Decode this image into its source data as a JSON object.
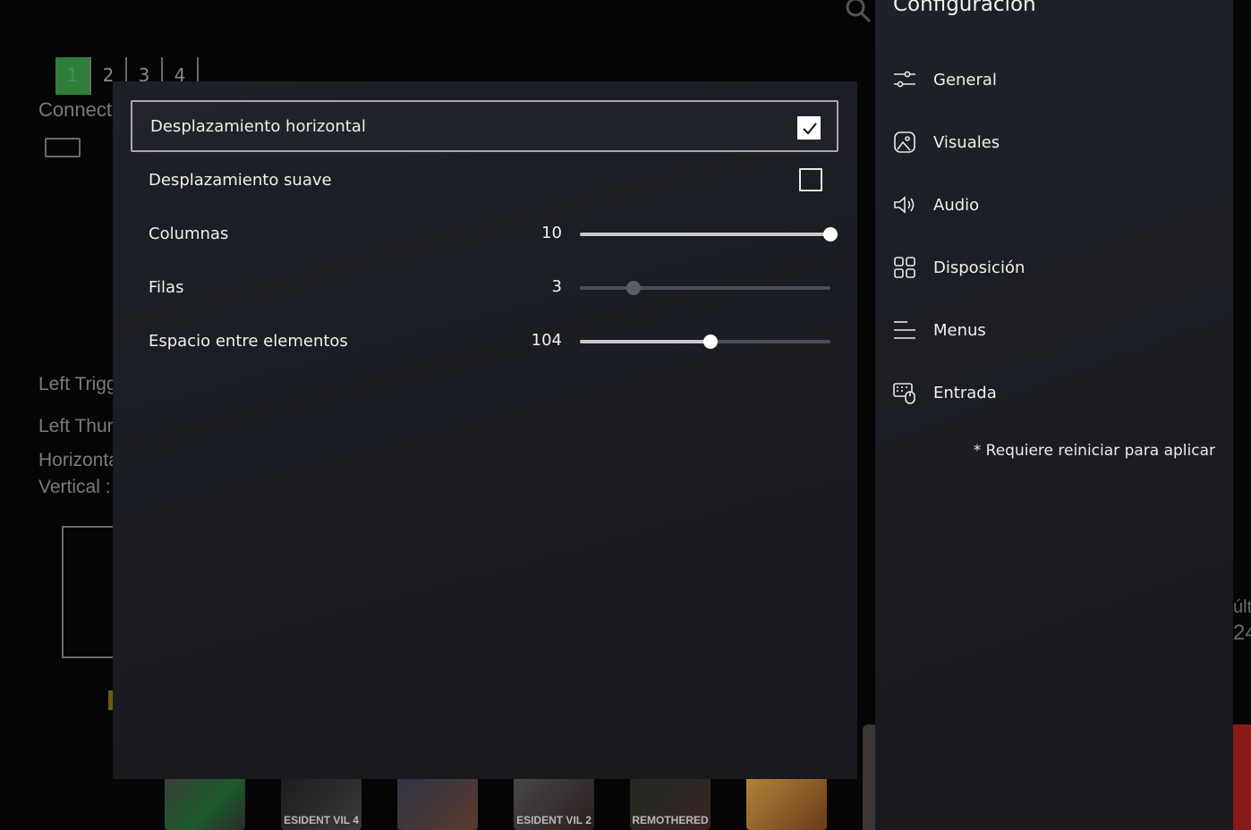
{
  "background": {
    "player_tabs": [
      "1",
      "2",
      "3",
      "4"
    ],
    "active_player_tab": "1",
    "connected_text": "Connecte",
    "left_trigger_text": "Left Trigg",
    "left_thumb_text": "Left Thun",
    "horizontal_text": "Horizonta",
    "vertical_text": "Vertical :",
    "right_edge_text_1": "últi",
    "right_edge_text_2": "24",
    "games": [
      "",
      "ESIDENT VIL 4",
      "",
      "ESIDENT VIL 2",
      "REMOTHERED",
      ""
    ]
  },
  "settings": {
    "horizontal_scroll": {
      "label": "Desplazamiento horizontal",
      "checked": true
    },
    "smooth_scroll": {
      "label": "Desplazamiento suave",
      "checked": false
    },
    "columns": {
      "label": "Columnas",
      "value": "10",
      "fraction": 1.0
    },
    "rows": {
      "label": "Filas",
      "value": "3",
      "fraction": 0.215
    },
    "spacing": {
      "label": "Espacio entre elementos",
      "value": "104",
      "fraction": 0.52
    }
  },
  "nav": {
    "title": "Configuración",
    "items": [
      {
        "label": "General",
        "icon": "sliders-icon"
      },
      {
        "label": "Visuales",
        "icon": "image-icon"
      },
      {
        "label": "Audio",
        "icon": "speaker-icon"
      },
      {
        "label": "Disposición",
        "icon": "grid-icon"
      },
      {
        "label": "Menus",
        "icon": "menu-lines-icon"
      },
      {
        "label": "Entrada",
        "icon": "keyboard-mouse-icon"
      }
    ],
    "note": "* Requiere reiniciar para aplicar"
  },
  "colors": {
    "panel_bg": "#1c1f25",
    "focus_border": "#b3a3b8",
    "accent_green": "#2f7d3a",
    "text": "#f0f0f0"
  }
}
